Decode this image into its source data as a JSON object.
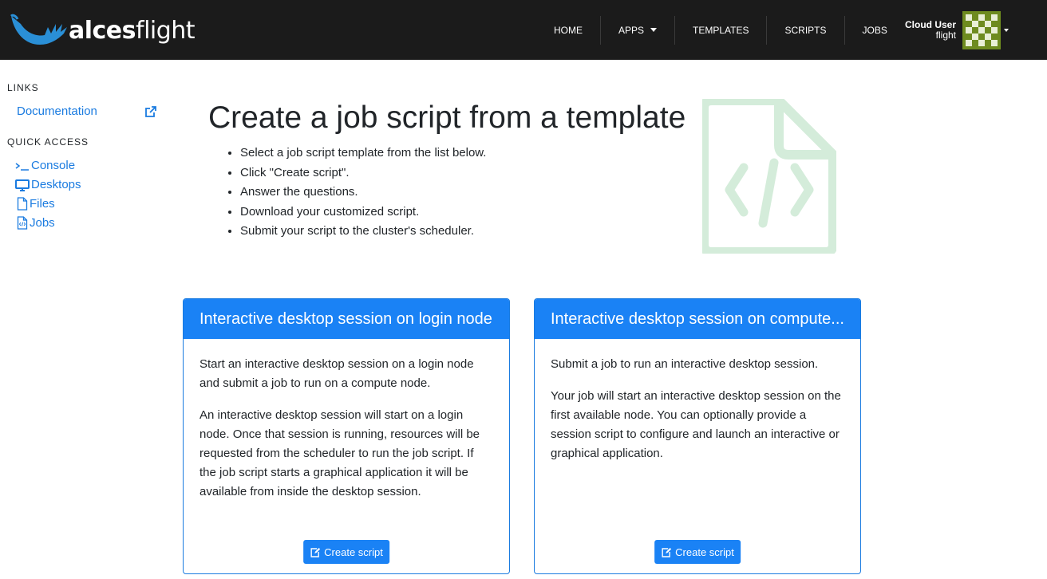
{
  "brand": {
    "name_bold": "alces",
    "name_light": "flight"
  },
  "nav": {
    "items": [
      {
        "label": "HOME"
      },
      {
        "label": "APPS"
      },
      {
        "label": "TEMPLATES"
      },
      {
        "label": "SCRIPTS"
      },
      {
        "label": "JOBS"
      }
    ],
    "user": {
      "name": "Cloud User",
      "sub": "flight"
    }
  },
  "sidebar": {
    "links_heading": "LINKS",
    "links": [
      {
        "label": "Documentation",
        "icon": "external-link-icon"
      }
    ],
    "quick_heading": "QUICK ACCESS",
    "quick": [
      {
        "label": "Console",
        "icon": "terminal-icon"
      },
      {
        "label": "Desktops",
        "icon": "monitor-icon"
      },
      {
        "label": "Files",
        "icon": "file-icon"
      },
      {
        "label": "Jobs",
        "icon": "file-code-icon"
      }
    ]
  },
  "main": {
    "title": "Create a job script from a template",
    "steps": [
      "Select a job script template from the list below.",
      "Click \"Create script\".",
      "Answer the questions.",
      "Download your customized script.",
      "Submit your script to the cluster's scheduler."
    ],
    "hero_icon": "file-code-icon"
  },
  "cards": [
    {
      "title": "Interactive desktop session on login node",
      "paragraphs": [
        "Start an interactive desktop session on a login node and submit a job to run on a compute node.",
        "An interactive desktop session will start on a login node. Once that session is running, resources will be requested from the scheduler to run the job script. If the job script starts a graphical application it will be available from inside the desktop session."
      ],
      "button": "Create script"
    },
    {
      "title": "Interactive desktop session on compute...",
      "paragraphs": [
        "Submit a job to run an interactive desktop session.",
        "Your job will start an interactive desktop session on the first available node. You can optionally provide a session script to configure and launch an interactive or graphical application."
      ],
      "button": "Create script"
    }
  ],
  "colors": {
    "navbar": "#1b1b1b",
    "primary": "#1a82f5",
    "link": "#1a7be0",
    "hero_icon": "#d4ecda",
    "logo": "#2a8fd6"
  }
}
